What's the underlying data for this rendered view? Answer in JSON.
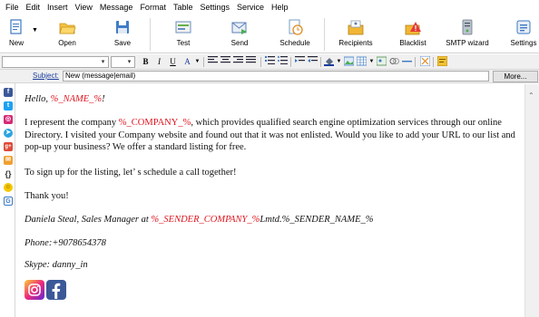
{
  "menu": [
    "File",
    "Edit",
    "Insert",
    "View",
    "Message",
    "Format",
    "Table",
    "Settings",
    "Service",
    "Help"
  ],
  "toolbar": {
    "new": "New",
    "open": "Open",
    "save": "Save",
    "test": "Test",
    "send": "Send",
    "schedule": "Schedule",
    "recipients": "Recipients",
    "blacklist": "Blacklist",
    "smtp_wizard": "SMTP wizard",
    "settings": "Settings"
  },
  "format_bar": {
    "font_value": "",
    "size_value": "",
    "bold": "B",
    "italic": "I",
    "underline": "U",
    "font_color": "A"
  },
  "subject": {
    "label": "Subject:",
    "value": "New (message|email)",
    "more_button": "More..."
  },
  "side_icons": [
    "facebook-icon",
    "twitter-icon",
    "instagram-icon",
    "telegram-icon",
    "google-plus-icon",
    "mail-icon",
    "braces-icon",
    "smiley-icon",
    "google-icon"
  ],
  "email": {
    "greeting_prefix": "Hello, ",
    "greeting_macro": "%_NAME_%",
    "greeting_suffix": "!",
    "para1_a": "I represent the company ",
    "para1_macro": "%_COMPANY_%",
    "para1_b": ", which provides qualified search engine optimization services through our online Directory. I visited your Company website and found out that it was not enlisted. Would you like to add your URL to our list and pop-up your business? We offer a standard listing for free.",
    "para2": "To sign up for the listing, let’ s schedule a call together!",
    "para3": "Thank you!",
    "sig_a": "Daniela Steal, Sales Manager at ",
    "sig_macro": "%_SENDER_COMPANY_%",
    "sig_b": "Lmtd.%_SENDER_NAME_%",
    "phone": "Phone:+9078654378",
    "skype": "Skype: danny_in"
  },
  "colors": {
    "macro": "#e0141e",
    "instagram": "#d62976",
    "facebook": "#3b5998"
  }
}
